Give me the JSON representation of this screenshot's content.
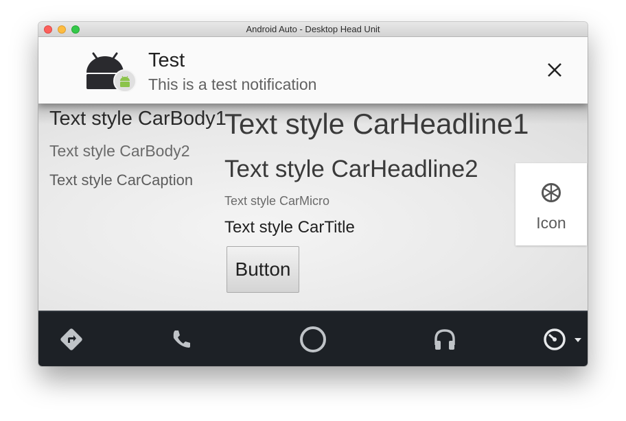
{
  "window": {
    "title": "Android Auto - Desktop Head Unit"
  },
  "notification": {
    "title": "Test",
    "body": "This is a test notification",
    "icon": "android-app-icon",
    "badge_icon": "android-robot-icon",
    "close_icon": "close-icon"
  },
  "content": {
    "text_styles": {
      "body1": "Text style CarBody1",
      "body2": "Text style CarBody2",
      "caption": "Text style CarCaption",
      "headline1": "Text style CarHeadline1",
      "headline2": "Text style CarHeadline2",
      "micro": "Text style CarMicro",
      "title": "Text style CarTitle"
    },
    "button_label": "Button",
    "icon_card": {
      "label": "Icon",
      "icon": "wheel-icon"
    }
  },
  "navbar": {
    "items": [
      {
        "name": "navigation",
        "icon": "directions-icon"
      },
      {
        "name": "phone",
        "icon": "phone-icon"
      },
      {
        "name": "home",
        "icon": "home-circle-icon"
      },
      {
        "name": "media",
        "icon": "headphones-icon"
      },
      {
        "name": "overview",
        "icon": "gauge-icon"
      }
    ]
  },
  "colors": {
    "navbar_bg": "#1d2126",
    "nav_icon": "#bfc3c7",
    "notification_bg": "#fafafa",
    "android_badge": "#8bc34a"
  }
}
